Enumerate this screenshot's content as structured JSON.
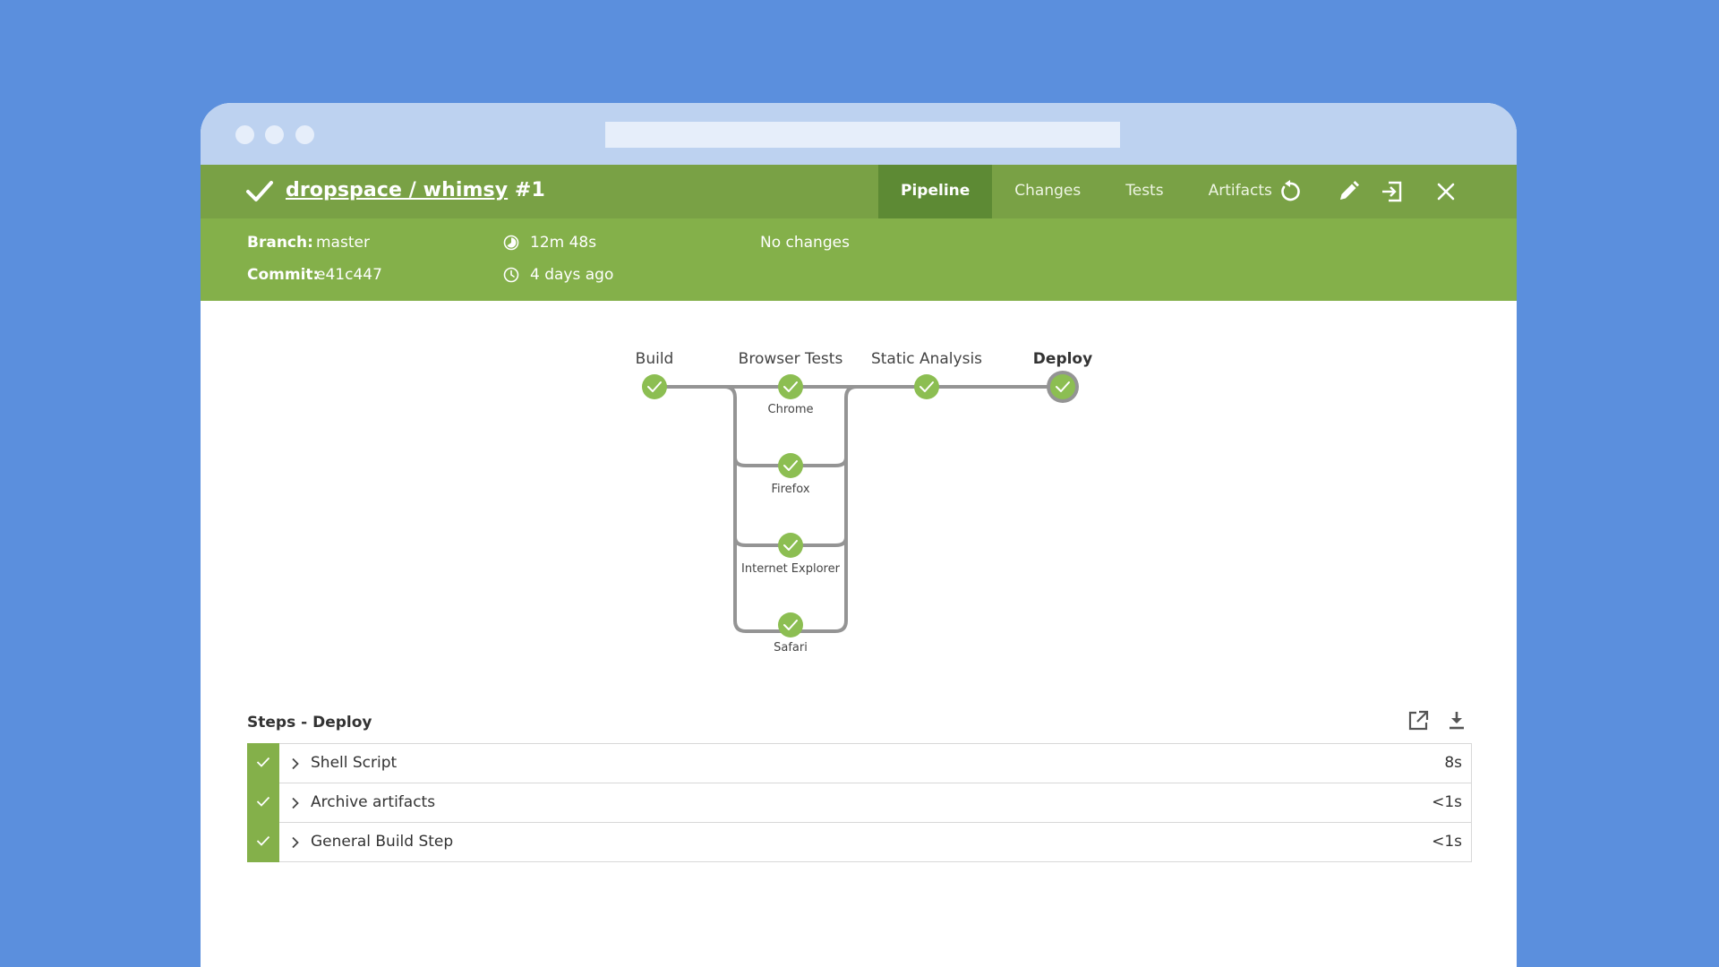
{
  "header": {
    "repo_link": "dropspace / whimsy",
    "run_number": "#1",
    "tabs": [
      {
        "label": "Pipeline",
        "active": true
      },
      {
        "label": "Changes",
        "active": false
      },
      {
        "label": "Tests",
        "active": false
      },
      {
        "label": "Artifacts",
        "active": false
      }
    ],
    "actions": [
      "replay-icon",
      "edit-icon",
      "open-classic-icon",
      "close-icon"
    ]
  },
  "meta": {
    "branch_label": "Branch:",
    "branch_value": "master",
    "commit_label": "Commit:",
    "commit_value": "e41c447",
    "duration": "12m 48s",
    "started": "4 days ago",
    "changes": "No changes"
  },
  "pipeline": {
    "stages": [
      "Build",
      "Browser Tests",
      "Static Analysis",
      "Deploy"
    ],
    "selected_stage": "Deploy",
    "parallel_branches": [
      "Chrome",
      "Firefox",
      "Internet Explorer",
      "Safari"
    ],
    "status": "success"
  },
  "steps": {
    "title": "Steps - Deploy",
    "items": [
      {
        "name": "Shell Script",
        "duration": "8s",
        "status": "success"
      },
      {
        "name": "Archive artifacts",
        "duration": "<1s",
        "status": "success"
      },
      {
        "name": "General Build Step",
        "duration": "<1s",
        "status": "success"
      }
    ]
  },
  "colors": {
    "background": "#5b8fdd",
    "header_dark": "#79a145",
    "header_light": "#84b04a",
    "success": "#8cbe52",
    "connector": "#949494"
  }
}
